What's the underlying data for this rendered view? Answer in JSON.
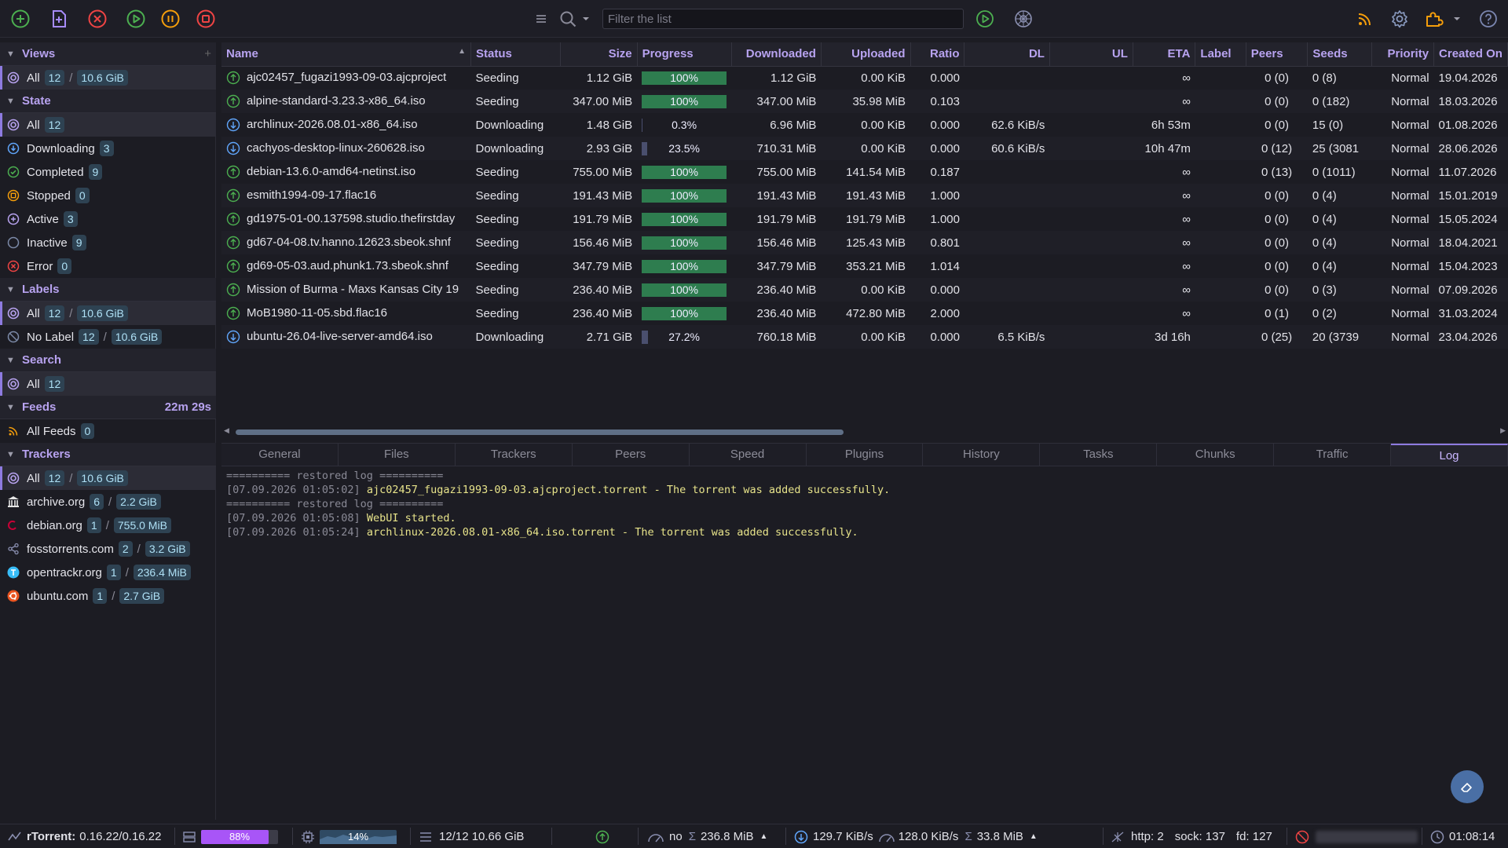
{
  "toolbar": {
    "filter_placeholder": "Filter the list"
  },
  "sidebar": {
    "views": {
      "title": "Views",
      "items": [
        {
          "label": "All",
          "count": "12",
          "size": "10.6 GiB"
        }
      ]
    },
    "state": {
      "title": "State",
      "items": [
        {
          "label": "All",
          "count": "12"
        },
        {
          "label": "Downloading",
          "count": "3"
        },
        {
          "label": "Completed",
          "count": "9"
        },
        {
          "label": "Stopped",
          "count": "0"
        },
        {
          "label": "Active",
          "count": "3"
        },
        {
          "label": "Inactive",
          "count": "9"
        },
        {
          "label": "Error",
          "count": "0"
        }
      ]
    },
    "labels": {
      "title": "Labels",
      "items": [
        {
          "label": "All",
          "count": "12",
          "size": "10.6 GiB"
        },
        {
          "label": "No Label",
          "count": "12",
          "size": "10.6 GiB"
        }
      ]
    },
    "search": {
      "title": "Search",
      "items": [
        {
          "label": "All",
          "count": "12"
        }
      ]
    },
    "feeds": {
      "title": "Feeds",
      "timer": "22m 29s",
      "items": [
        {
          "label": "All Feeds",
          "count": "0"
        }
      ]
    },
    "trackers": {
      "title": "Trackers",
      "items": [
        {
          "label": "All",
          "count": "12",
          "size": "10.6 GiB"
        },
        {
          "label": "archive.org",
          "count": "6",
          "size": "2.2 GiB"
        },
        {
          "label": "debian.org",
          "count": "1",
          "size": "755.0 MiB"
        },
        {
          "label": "fosstorrents.com",
          "count": "2",
          "size": "3.2 GiB"
        },
        {
          "label": "opentrackr.org",
          "count": "1",
          "size": "236.4 MiB"
        },
        {
          "label": "ubuntu.com",
          "count": "1",
          "size": "2.7 GiB"
        }
      ]
    }
  },
  "table": {
    "columns": [
      "Name",
      "Status",
      "Size",
      "Progress",
      "Downloaded",
      "Uploaded",
      "Ratio",
      "DL",
      "UL",
      "ETA",
      "Label",
      "Peers",
      "Seeds",
      "Priority",
      "Created On"
    ],
    "rows": [
      {
        "name": "ajc02457_fugazi1993-09-03.ajcproject",
        "status": "Seeding",
        "size": "1.12 GiB",
        "progress": 100,
        "progress_text": "100%",
        "downloaded": "1.12 GiB",
        "uploaded": "0.00 KiB",
        "ratio": "0.000",
        "dl": "",
        "ul": "",
        "eta": "∞",
        "label": "",
        "peers": "0 (0)",
        "seeds": "0 (8)",
        "priority": "Normal",
        "created": "19.04.2026",
        "kind": "seed"
      },
      {
        "name": "alpine-standard-3.23.3-x86_64.iso",
        "status": "Seeding",
        "size": "347.00 MiB",
        "progress": 100,
        "progress_text": "100%",
        "downloaded": "347.00 MiB",
        "uploaded": "35.98 MiB",
        "ratio": "0.103",
        "dl": "",
        "ul": "",
        "eta": "∞",
        "label": "",
        "peers": "0 (0)",
        "seeds": "0 (182)",
        "priority": "Normal",
        "created": "18.03.2026",
        "kind": "seed"
      },
      {
        "name": "archlinux-2026.08.01-x86_64.iso",
        "status": "Downloading",
        "size": "1.48 GiB",
        "progress": 0.3,
        "progress_text": "0.3%",
        "downloaded": "6.96 MiB",
        "uploaded": "0.00 KiB",
        "ratio": "0.000",
        "dl": "62.6 KiB/s",
        "ul": "",
        "eta": "6h 53m",
        "label": "",
        "peers": "0 (0)",
        "seeds": "15 (0)",
        "priority": "Normal",
        "created": "01.08.2026",
        "kind": "dl"
      },
      {
        "name": "cachyos-desktop-linux-260628.iso",
        "status": "Downloading",
        "size": "2.93 GiB",
        "progress": 23.5,
        "progress_text": "23.5%",
        "downloaded": "710.31 MiB",
        "uploaded": "0.00 KiB",
        "ratio": "0.000",
        "dl": "60.6 KiB/s",
        "ul": "",
        "eta": "10h 47m",
        "label": "",
        "peers": "0 (12)",
        "seeds": "25 (3081",
        "priority": "Normal",
        "created": "28.06.2026",
        "kind": "dl"
      },
      {
        "name": "debian-13.6.0-amd64-netinst.iso",
        "status": "Seeding",
        "size": "755.00 MiB",
        "progress": 100,
        "progress_text": "100%",
        "downloaded": "755.00 MiB",
        "uploaded": "141.54 MiB",
        "ratio": "0.187",
        "dl": "",
        "ul": "",
        "eta": "∞",
        "label": "",
        "peers": "0 (13)",
        "seeds": "0 (1011)",
        "priority": "Normal",
        "created": "11.07.2026",
        "kind": "seed"
      },
      {
        "name": "esmith1994-09-17.flac16",
        "status": "Seeding",
        "size": "191.43 MiB",
        "progress": 100,
        "progress_text": "100%",
        "downloaded": "191.43 MiB",
        "uploaded": "191.43 MiB",
        "ratio": "1.000",
        "dl": "",
        "ul": "",
        "eta": "∞",
        "label": "",
        "peers": "0 (0)",
        "seeds": "0 (4)",
        "priority": "Normal",
        "created": "15.01.2019",
        "kind": "seed"
      },
      {
        "name": "gd1975-01-00.137598.studio.thefirstday",
        "status": "Seeding",
        "size": "191.79 MiB",
        "progress": 100,
        "progress_text": "100%",
        "downloaded": "191.79 MiB",
        "uploaded": "191.79 MiB",
        "ratio": "1.000",
        "dl": "",
        "ul": "",
        "eta": "∞",
        "label": "",
        "peers": "0 (0)",
        "seeds": "0 (4)",
        "priority": "Normal",
        "created": "15.05.2024",
        "kind": "seed"
      },
      {
        "name": "gd67-04-08.tv.hanno.12623.sbeok.shnf",
        "status": "Seeding",
        "size": "156.46 MiB",
        "progress": 100,
        "progress_text": "100%",
        "downloaded": "156.46 MiB",
        "uploaded": "125.43 MiB",
        "ratio": "0.801",
        "dl": "",
        "ul": "",
        "eta": "∞",
        "label": "",
        "peers": "0 (0)",
        "seeds": "0 (4)",
        "priority": "Normal",
        "created": "18.04.2021",
        "kind": "seed"
      },
      {
        "name": "gd69-05-03.aud.phunk1.73.sbeok.shnf",
        "status": "Seeding",
        "size": "347.79 MiB",
        "progress": 100,
        "progress_text": "100%",
        "downloaded": "347.79 MiB",
        "uploaded": "353.21 MiB",
        "ratio": "1.014",
        "dl": "",
        "ul": "",
        "eta": "∞",
        "label": "",
        "peers": "0 (0)",
        "seeds": "0 (4)",
        "priority": "Normal",
        "created": "15.04.2023",
        "kind": "seed"
      },
      {
        "name": "Mission of Burma - Maxs Kansas City 19",
        "status": "Seeding",
        "size": "236.40 MiB",
        "progress": 100,
        "progress_text": "100%",
        "downloaded": "236.40 MiB",
        "uploaded": "0.00 KiB",
        "ratio": "0.000",
        "dl": "",
        "ul": "",
        "eta": "∞",
        "label": "",
        "peers": "0 (0)",
        "seeds": "0 (3)",
        "priority": "Normal",
        "created": "07.09.2026",
        "kind": "seed"
      },
      {
        "name": "MoB1980-11-05.sbd.flac16",
        "status": "Seeding",
        "size": "236.40 MiB",
        "progress": 100,
        "progress_text": "100%",
        "downloaded": "236.40 MiB",
        "uploaded": "472.80 MiB",
        "ratio": "2.000",
        "dl": "",
        "ul": "",
        "eta": "∞",
        "label": "",
        "peers": "0 (1)",
        "seeds": "0 (2)",
        "priority": "Normal",
        "created": "31.03.2024",
        "kind": "seed"
      },
      {
        "name": "ubuntu-26.04-live-server-amd64.iso",
        "status": "Downloading",
        "size": "2.71 GiB",
        "progress": 27.2,
        "progress_text": "27.2%",
        "downloaded": "760.18 MiB",
        "uploaded": "0.00 KiB",
        "ratio": "0.000",
        "dl": "6.5 KiB/s",
        "ul": "",
        "eta": "3d 16h",
        "label": "",
        "peers": "0 (25)",
        "seeds": "20 (3739",
        "priority": "Normal",
        "created": "23.04.2026",
        "kind": "dl"
      }
    ]
  },
  "tabs": [
    "General",
    "Files",
    "Trackers",
    "Peers",
    "Speed",
    "Plugins",
    "History",
    "Tasks",
    "Chunks",
    "Traffic",
    "Log"
  ],
  "active_tab": "Log",
  "log": [
    {
      "ts": "========== restored log ==========",
      "msg": ""
    },
    {
      "ts": "[07.09.2026 01:05:02]",
      "msg": "ajc02457_fugazi1993-09-03.ajcproject.torrent - The torrent was added successfully."
    },
    {
      "ts": "========== restored log ==========",
      "msg": ""
    },
    {
      "ts": "[07.09.2026 01:05:08]",
      "msg": "WebUI started."
    },
    {
      "ts": "[07.09.2026 01:05:24]",
      "msg": "archlinux-2026.08.01-x86_64.iso.torrent - The torrent was added successfully."
    }
  ],
  "status": {
    "client_label": "rTorrent:",
    "client_version": "0.16.22/0.16.22",
    "disk_percent": 88,
    "disk_text": "88%",
    "cpu_percent": 14,
    "cpu_text": "14%",
    "torrents_summary": "12/12 10.66 GiB",
    "dl_limit": "no",
    "dl_total": "236.8 MiB",
    "dl_speed": "129.7 KiB/s",
    "ul_speed": "128.0 KiB/s",
    "ul_total": "33.8 MiB",
    "http": "http: 2",
    "sock": "sock: 137",
    "fd": "fd: 127",
    "clock": "01:08:14"
  },
  "colors": {
    "accent": "#b8a3f0",
    "seed_green": "#2e7d4f",
    "log_text": "#e7e38a"
  }
}
